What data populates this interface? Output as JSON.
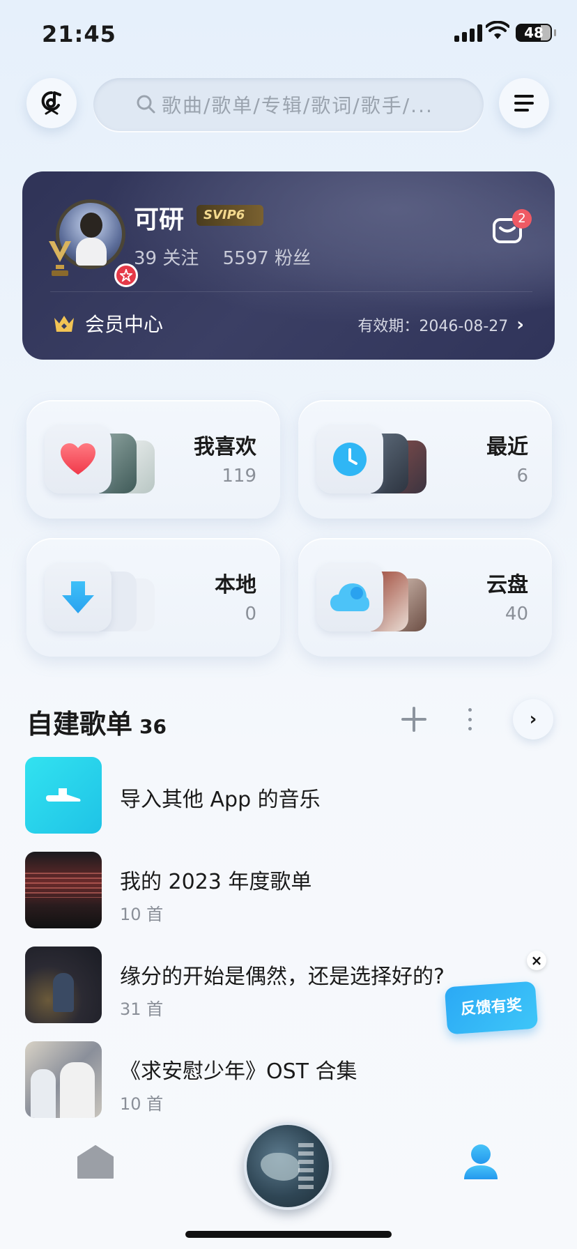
{
  "status_bar": {
    "time": "21:45",
    "battery": "48"
  },
  "search": {
    "placeholder": "歌曲/歌单/专辑/歌词/歌手/..."
  },
  "profile": {
    "name": "可研",
    "vip_badge": "SVIP6",
    "follow": "39 关注",
    "fans": "5597 粉丝",
    "mail_count": "2",
    "member_center": "会员中心",
    "expiry": "有效期：2046-08-27"
  },
  "tiles": [
    {
      "name": "我喜欢",
      "count": "119"
    },
    {
      "name": "最近",
      "count": "6"
    },
    {
      "name": "本地",
      "count": "0"
    },
    {
      "name": "云盘",
      "count": "40"
    }
  ],
  "playlists_section": {
    "title": "自建歌单",
    "count": "36"
  },
  "playlists": [
    {
      "title": "导入其他 App 的音乐",
      "sub": ""
    },
    {
      "title": "我的 2023 年度歌单",
      "sub": "10 首"
    },
    {
      "title": "缘分的开始是偶然，还是选择好的?",
      "sub": "31 首"
    },
    {
      "title": "《求安慰少年》OST 合集",
      "sub": "10 首"
    }
  ],
  "feedback": {
    "label": "反馈有奖",
    "close": "×"
  },
  "colors": {
    "accent": "#2ba9f5",
    "card_bg": "#343860",
    "badge_red": "#ef5a64",
    "me_blue": "#2ea8f3"
  }
}
